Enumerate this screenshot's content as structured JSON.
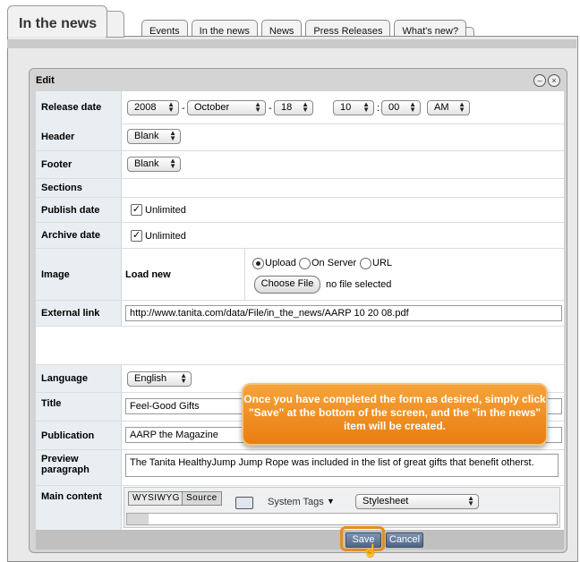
{
  "main_tab": "In the news",
  "sub_tabs": [
    "Events",
    "In the news",
    "News",
    "Press Releases",
    "What's new?"
  ],
  "panel": {
    "title": "Edit"
  },
  "form": {
    "release_date": {
      "label": "Release date",
      "year": "2008",
      "month": "October",
      "day": "18",
      "hour": "10",
      "minute": "00",
      "ampm": "AM",
      "sep_dash": "-",
      "sep_colon": ":"
    },
    "header": {
      "label": "Header",
      "value": "Blank"
    },
    "footer": {
      "label": "Footer",
      "value": "Blank"
    },
    "sections": {
      "label": "Sections"
    },
    "publish_date": {
      "label": "Publish date",
      "checkbox_label": "Unlimited",
      "checked": true
    },
    "archive_date": {
      "label": "Archive date",
      "checkbox_label": "Unlimited",
      "checked": true
    },
    "image": {
      "label": "Image",
      "sub_label": "Load new",
      "radios": [
        "Upload",
        "On Server",
        "URL"
      ],
      "selected": "Upload",
      "choose_file": "Choose File",
      "no_file": "no file selected"
    },
    "external_link": {
      "label": "External link",
      "value": "http://www.tanita.com/data/File/in_the_news/AARP 10 20 08.pdf"
    },
    "language": {
      "label": "Language",
      "value": "English"
    },
    "title": {
      "label": "Title",
      "value": "Feel-Good Gifts"
    },
    "publication": {
      "label": "Publication",
      "value": "AARP the Magazine"
    },
    "preview_paragraph": {
      "label": "Preview paragraph",
      "value": "The Tanita HealthyJump Jump Rope was included in the list of great gifts that benefit otherst."
    },
    "main_content": {
      "label": "Main content",
      "wysiwyg": "WYSIWYG",
      "source": "Source",
      "system_tags": "System Tags",
      "stylesheet": "Stylesheet"
    }
  },
  "buttons": {
    "save": "Save",
    "cancel": "Cancel"
  },
  "callout": "Once you have completed the form as desired, simply click \"Save\" at the bottom of the screen, and the \"in the news\" item will be created.",
  "colors": {
    "callout": "#f0901f",
    "label_bg": "#e9eef2",
    "button_blue": "#5b7295"
  }
}
